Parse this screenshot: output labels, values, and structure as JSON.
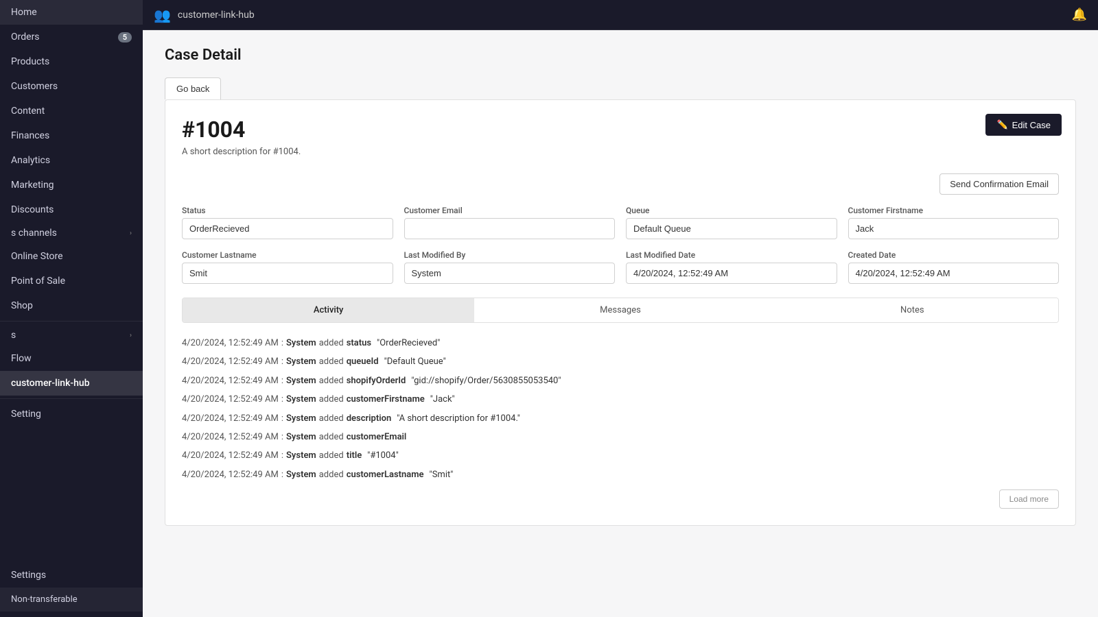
{
  "sidebar": {
    "nav_items": [
      {
        "id": "home",
        "label": "Home",
        "badge": null,
        "active": false
      },
      {
        "id": "orders",
        "label": "Orders",
        "badge": "5",
        "active": false
      },
      {
        "id": "products",
        "label": "Products",
        "badge": null,
        "active": false
      },
      {
        "id": "customers",
        "label": "Customers",
        "badge": null,
        "active": false
      },
      {
        "id": "content",
        "label": "Content",
        "badge": null,
        "active": false
      },
      {
        "id": "finances",
        "label": "Finances",
        "badge": null,
        "active": false
      },
      {
        "id": "analytics",
        "label": "Analytics",
        "badge": null,
        "active": false
      },
      {
        "id": "marketing",
        "label": "Marketing",
        "badge": null,
        "active": false
      },
      {
        "id": "discounts",
        "label": "Discounts",
        "badge": null,
        "active": false
      }
    ],
    "channels_label": "s channels",
    "channel_items": [
      {
        "id": "online-store",
        "label": "Online Store"
      },
      {
        "id": "point-of-sale",
        "label": "Point of Sale"
      },
      {
        "id": "shop",
        "label": "Shop"
      }
    ],
    "apps_label": "s",
    "app_items": [
      {
        "id": "flow",
        "label": "Flow"
      },
      {
        "id": "customer-link-hub",
        "label": "customer-link-hub",
        "active": true
      }
    ],
    "bottom_items": [
      {
        "id": "setting",
        "label": "Setting"
      }
    ],
    "settings_label": "Settings",
    "non_transferable_label": "Non-transferable"
  },
  "topbar": {
    "icon": "👥",
    "title": "customer-link-hub",
    "bell_icon": "🔔"
  },
  "page": {
    "title": "Case Detail",
    "go_back_label": "Go back",
    "edit_case_label": "Edit Case",
    "edit_icon": "✏️",
    "case_id": "#1004",
    "case_description": "A short description for #1004.",
    "send_confirmation_label": "Send Confirmation Email",
    "fields": [
      {
        "label": "Status",
        "value": "OrderRecieved",
        "id": "status"
      },
      {
        "label": "Customer Email",
        "value": "",
        "id": "customer-email"
      },
      {
        "label": "Queue",
        "value": "Default Queue",
        "id": "queue"
      },
      {
        "label": "Customer Firstname",
        "value": "Jack",
        "id": "customer-firstname"
      },
      {
        "label": "Customer Lastname",
        "value": "Smit",
        "id": "customer-lastname"
      },
      {
        "label": "Last Modified By",
        "value": "System",
        "id": "last-modified-by"
      },
      {
        "label": "Last Modified Date",
        "value": "4/20/2024, 12:52:49 AM",
        "id": "last-modified-date"
      },
      {
        "label": "Created Date",
        "value": "4/20/2024, 12:52:49 AM",
        "id": "created-date"
      }
    ],
    "tabs": [
      {
        "id": "activity",
        "label": "Activity",
        "active": true
      },
      {
        "id": "messages",
        "label": "Messages",
        "active": false
      },
      {
        "id": "notes",
        "label": "Notes",
        "active": false
      }
    ],
    "activity_rows": [
      {
        "timestamp": "4/20/2024, 12:52:49 AM",
        "actor": "System",
        "action": "added",
        "field": "status",
        "value": "\"OrderRecieved\""
      },
      {
        "timestamp": "4/20/2024, 12:52:49 AM",
        "actor": "System",
        "action": "added",
        "field": "queueId",
        "value": "\"Default Queue\""
      },
      {
        "timestamp": "4/20/2024, 12:52:49 AM",
        "actor": "System",
        "action": "added",
        "field": "shopifyOrderId",
        "value": "\"gid://shopify/Order/5630855053540\""
      },
      {
        "timestamp": "4/20/2024, 12:52:49 AM",
        "actor": "System",
        "action": "added",
        "field": "customerFirstname",
        "value": "\"Jack\""
      },
      {
        "timestamp": "4/20/2024, 12:52:49 AM",
        "actor": "System",
        "action": "added",
        "field": "description",
        "value": "\"A short description for #1004.\""
      },
      {
        "timestamp": "4/20/2024, 12:52:49 AM",
        "actor": "System",
        "action": "added",
        "field": "customerEmail",
        "value": ""
      },
      {
        "timestamp": "4/20/2024, 12:52:49 AM",
        "actor": "System",
        "action": "added",
        "field": "title",
        "value": "\"#1004\""
      },
      {
        "timestamp": "4/20/2024, 12:52:49 AM",
        "actor": "System",
        "action": "added",
        "field": "customerLastname",
        "value": "\"Smit\""
      }
    ],
    "load_more_label": "Load more"
  }
}
